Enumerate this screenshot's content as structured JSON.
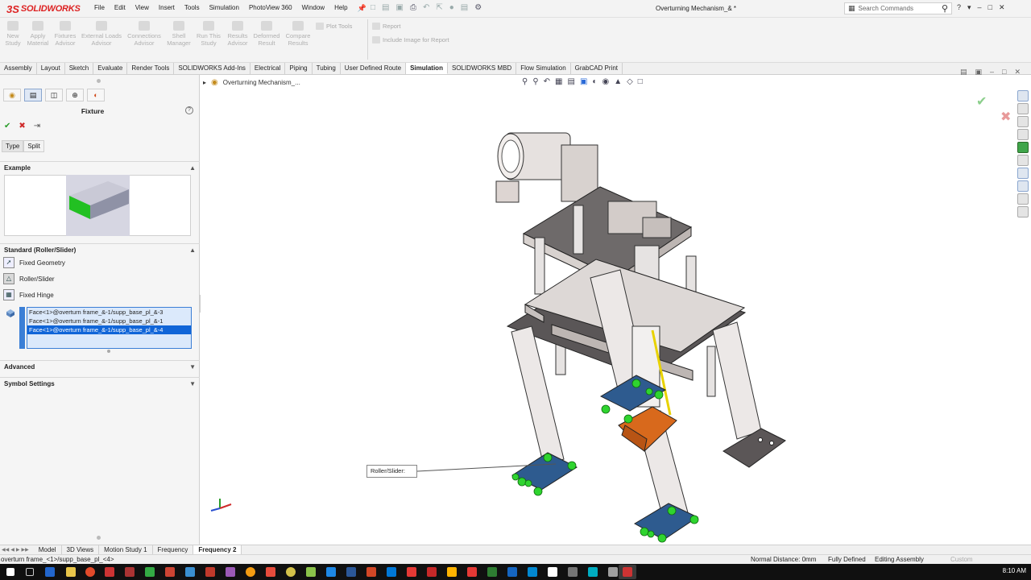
{
  "app": {
    "brand": "SOLIDWORKS",
    "menu": [
      "File",
      "Edit",
      "View",
      "Insert",
      "Tools",
      "Simulation",
      "PhotoView 360",
      "Window",
      "Help"
    ],
    "document_title": "Overturning Mechanism_& *",
    "search_placeholder": "Search Commands",
    "help_label": "?"
  },
  "command_manager": {
    "buttons": [
      {
        "label1": "New",
        "label2": "Study"
      },
      {
        "label1": "Apply",
        "label2": "Material"
      },
      {
        "label1": "Fixtures",
        "label2": "Advisor"
      },
      {
        "label1": "External Loads",
        "label2": "Advisor"
      },
      {
        "label1": "Connections",
        "label2": "Advisor"
      },
      {
        "label1": "Shell",
        "label2": "Manager"
      },
      {
        "label1": "Run This",
        "label2": "Study"
      },
      {
        "label1": "Results",
        "label2": "Advisor"
      },
      {
        "label1": "Deformed",
        "label2": "Result"
      },
      {
        "label1": "Compare",
        "label2": "Results"
      }
    ],
    "plot_tools": "Plot Tools",
    "report": "Report",
    "include_image": "Include Image for Report"
  },
  "cmd_tabs": [
    "Assembly",
    "Layout",
    "Sketch",
    "Evaluate",
    "Render Tools",
    "SOLIDWORKS Add-Ins",
    "Electrical",
    "Piping",
    "Tubing",
    "User Defined Route",
    "Simulation",
    "SOLIDWORKS MBD",
    "Flow Simulation",
    "GrabCAD Print"
  ],
  "active_cmd_tab": "Simulation",
  "property_manager": {
    "title": "Fixture",
    "type_tabs": [
      "Type",
      "Split"
    ],
    "example_label": "Example",
    "standard_label": "Standard (Roller/Slider)",
    "options": [
      "Fixed Geometry",
      "Roller/Slider",
      "Fixed Hinge"
    ],
    "selections": [
      "Face<1>@overturn frame_&-1/supp_base_pl_&-3",
      "Face<1>@overturn frame_&-1/supp_base_pl_&-1",
      "Face<1>@overturn frame_&-1/supp_base_pl_&-4"
    ],
    "selected_index": 2,
    "advanced_label": "Advanced",
    "symbol_settings_label": "Symbol Settings"
  },
  "viewport": {
    "tree_label": "Overturning Mechanism_...",
    "callout": "Roller/Slider:"
  },
  "bottom_tabs": [
    "Model",
    "3D Views",
    "Motion Study 1",
    "Frequency",
    "Frequency 2"
  ],
  "active_bottom_tab": "Frequency 2",
  "status": {
    "left": "overturn frame_<1>/supp_base_pl_<4>",
    "normal_distance": "Normal Distance: 0mm",
    "definition": "Fully Defined",
    "mode": "Editing Assembly",
    "units": "Custom"
  },
  "taskbar": {
    "time": "8:10 AM"
  },
  "colors": {
    "accent": "#1065d8",
    "fixture_green": "#2fd42f",
    "logo_red": "#dd2222",
    "ok_green": "#2a9d2a",
    "cancel_red": "#cf2a2a"
  }
}
